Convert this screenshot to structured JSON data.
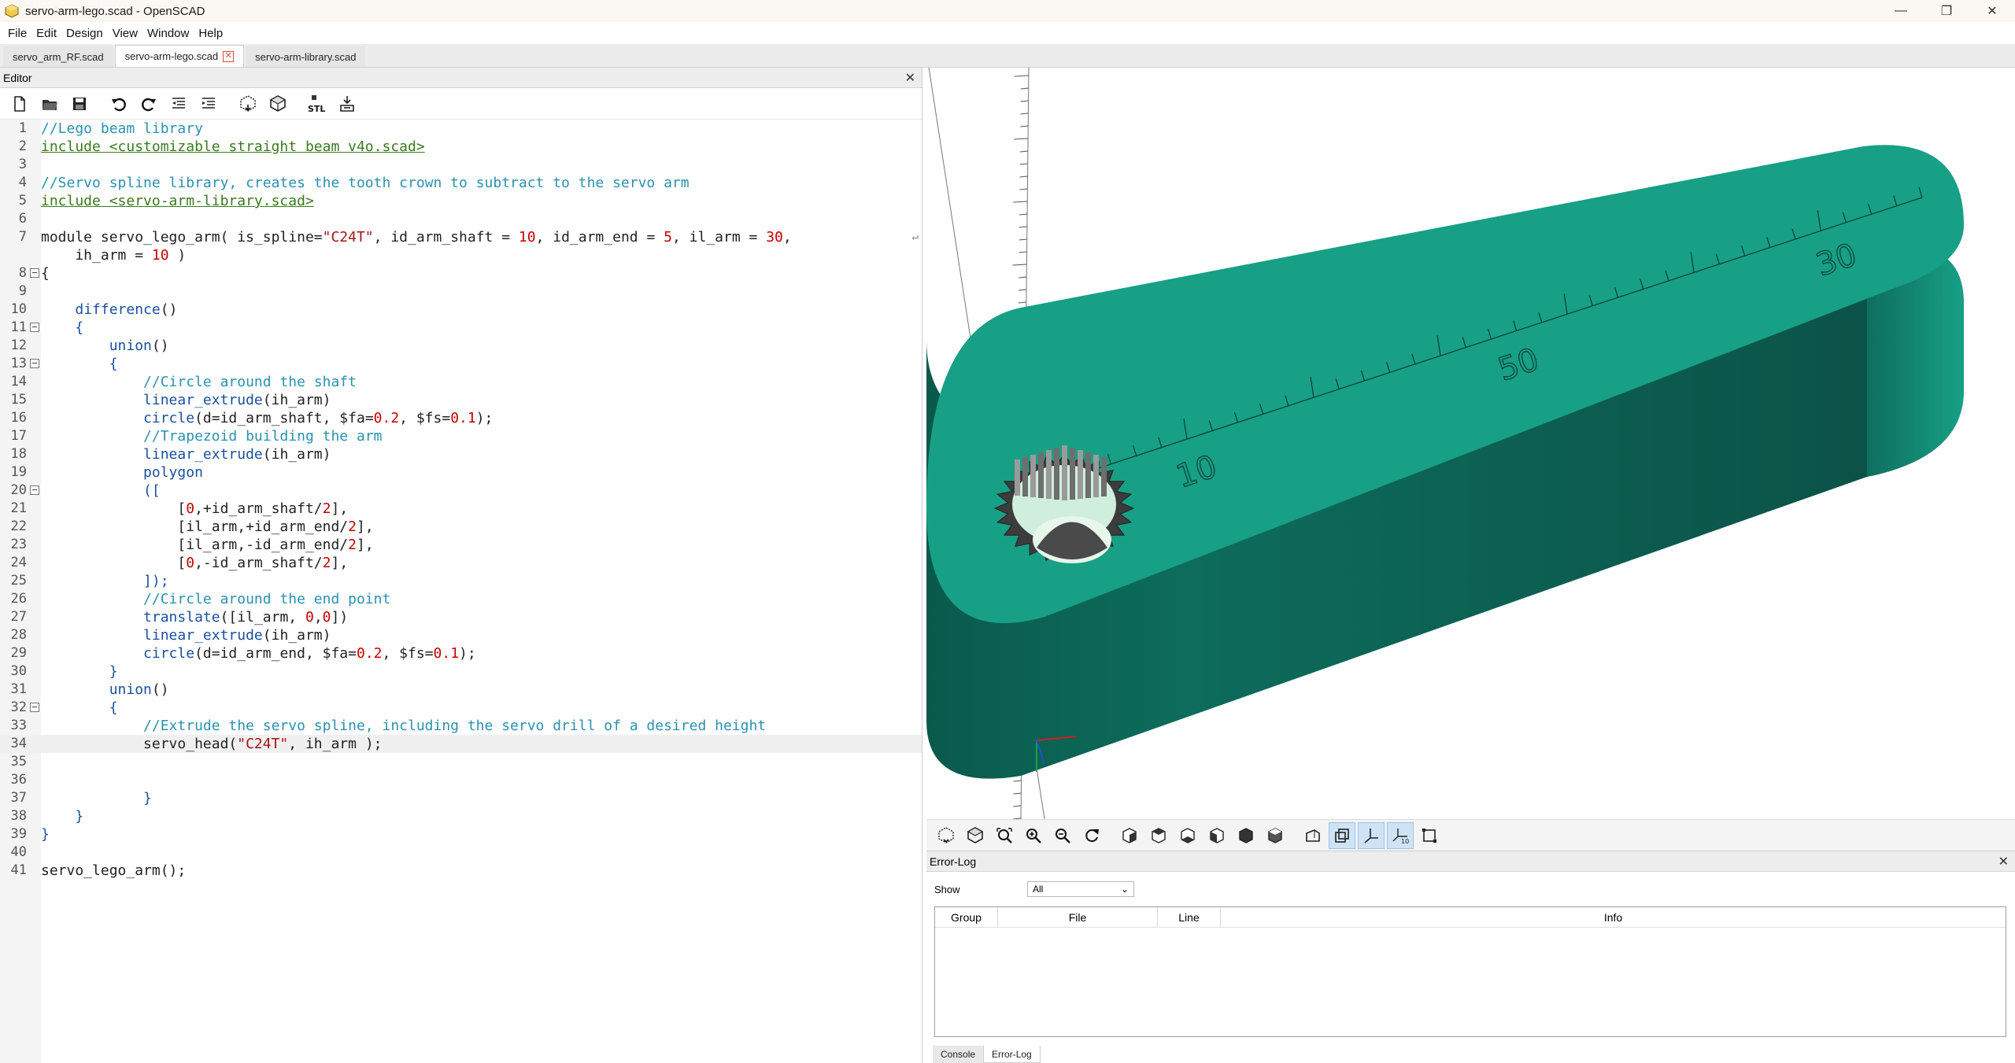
{
  "window": {
    "title": "servo-arm-lego.scad - OpenSCAD",
    "minimize_glyph": "—",
    "restore_glyph": "❐",
    "close_glyph": "✕"
  },
  "menu": [
    "File",
    "Edit",
    "Design",
    "View",
    "Window",
    "Help"
  ],
  "tabs": [
    {
      "label": "servo_arm_RF.scad",
      "active": false
    },
    {
      "label": "servo-arm-lego.scad",
      "active": true
    },
    {
      "label": "servo-arm-library.scad",
      "active": false
    }
  ],
  "editor": {
    "title": "Editor",
    "close_glyph": "✕",
    "toolbar_icons": [
      "new-file-icon",
      "open-file-icon",
      "save-icon",
      "undo-icon",
      "redo-icon",
      "unindent-icon",
      "indent-icon",
      "preview-icon",
      "render-icon",
      "export-stl-icon",
      "send-to-print-icon"
    ],
    "stl_label": "STL",
    "lines": [
      {
        "n": "1",
        "html": "<span class='c-comment'>//Lego beam library</span>"
      },
      {
        "n": "2",
        "html": "<span class='c-include'>include &lt;customizable straight beam v4o.scad&gt;</span>"
      },
      {
        "n": "3",
        "html": ""
      },
      {
        "n": "4",
        "html": "<span class='c-comment'>//Servo spline library, creates the tooth crown to subtract to the servo arm</span>"
      },
      {
        "n": "5",
        "html": "<span class='c-include'>include &lt;servo-arm-library.scad&gt;</span>"
      },
      {
        "n": "6",
        "html": ""
      },
      {
        "n": "7",
        "html": "module servo_lego_arm( is_spline=<span class='c-str'>\"C24T\"</span>, id_arm_shaft = <span class='c-num'>10</span>, id_arm_end = <span class='c-num'>5</span>, il_arm = <span class='c-num'>30</span>,",
        "wrap": true
      },
      {
        "n": "",
        "html": "    ih_arm = <span class='c-num'>10</span> )"
      },
      {
        "n": "8",
        "html": "{",
        "fold": true
      },
      {
        "n": "9",
        "html": ""
      },
      {
        "n": "10",
        "html": "    <span class='c-kw'>difference</span>()"
      },
      {
        "n": "11",
        "html": "    <span class='c-kw'>{</span>",
        "fold": true
      },
      {
        "n": "12",
        "html": "        <span class='c-kw'>union</span>()"
      },
      {
        "n": "13",
        "html": "        <span class='c-kw'>{</span>",
        "fold": true
      },
      {
        "n": "14",
        "html": "            <span class='c-comment'>//Circle around the shaft</span>"
      },
      {
        "n": "15",
        "html": "            <span class='c-kw'>linear_extrude</span>(ih_arm)"
      },
      {
        "n": "16",
        "html": "            <span class='c-kw'>circle</span>(d=id_arm_shaft, $fa=<span class='c-num'>0.2</span>, $fs=<span class='c-num'>0.1</span>);"
      },
      {
        "n": "17",
        "html": "            <span class='c-comment'>//Trapezoid building the arm</span>"
      },
      {
        "n": "18",
        "html": "            <span class='c-kw'>linear_extrude</span>(ih_arm)"
      },
      {
        "n": "19",
        "html": "            <span class='c-kw'>polygon</span>"
      },
      {
        "n": "20",
        "html": "            <span class='c-kw'>([</span>",
        "fold": true
      },
      {
        "n": "21",
        "html": "                [<span class='c-num'>0</span>,+id_arm_shaft/<span class='c-num'>2</span>],"
      },
      {
        "n": "22",
        "html": "                [il_arm,+id_arm_end/<span class='c-num'>2</span>],"
      },
      {
        "n": "23",
        "html": "                [il_arm,-id_arm_end/<span class='c-num'>2</span>],"
      },
      {
        "n": "24",
        "html": "                [<span class='c-num'>0</span>,-id_arm_shaft/<span class='c-num'>2</span>],"
      },
      {
        "n": "25",
        "html": "            <span class='c-kw'>]);</span>"
      },
      {
        "n": "26",
        "html": "            <span class='c-comment'>//Circle around the end point</span>"
      },
      {
        "n": "27",
        "html": "            <span class='c-kw'>translate</span>([il_arm, <span class='c-num'>0</span>,<span class='c-num'>0</span>])"
      },
      {
        "n": "28",
        "html": "            <span class='c-kw'>linear_extrude</span>(ih_arm)"
      },
      {
        "n": "29",
        "html": "            <span class='c-kw'>circle</span>(d=id_arm_end, $fa=<span class='c-num'>0.2</span>, $fs=<span class='c-num'>0.1</span>);"
      },
      {
        "n": "30",
        "html": "        <span class='c-kw'>}</span>"
      },
      {
        "n": "31",
        "html": "        <span class='c-kw'>union</span>()"
      },
      {
        "n": "32",
        "html": "        <span class='c-kw'>{</span>",
        "fold": true
      },
      {
        "n": "33",
        "html": "            <span class='c-comment'>//Extrude the servo spline, including the servo drill of a desired height</span>"
      },
      {
        "n": "34",
        "html": "            servo_head(<span class='c-str'>\"C24T\"</span>, ih_arm );",
        "current": true
      },
      {
        "n": "35",
        "html": ""
      },
      {
        "n": "36",
        "html": ""
      },
      {
        "n": "37",
        "html": "            <span class='c-kw'>}</span>"
      },
      {
        "n": "38",
        "html": "    <span class='c-kw'>}</span>"
      },
      {
        "n": "39",
        "html": "<span class='c-kw'>}</span>"
      },
      {
        "n": "40",
        "html": ""
      },
      {
        "n": "41",
        "html": "servo_lego_arm();"
      }
    ]
  },
  "viewport": {
    "model_color": "#17a085",
    "model_side_color": "#0e6b5c",
    "ruler_labels": [
      "10",
      "50",
      "30"
    ]
  },
  "view_toolbar": {
    "icons": [
      "preview-icon",
      "render-icon",
      "view-all-icon",
      "zoom-in-icon",
      "zoom-out-icon",
      "reset-view-icon",
      "view-right-icon",
      "view-top-icon",
      "view-bottom-icon",
      "view-left-icon",
      "view-front-icon",
      "view-back-icon",
      "perspective-icon",
      "orthogonal-icon",
      "show-axes-icon",
      "show-scale-markers-icon",
      "show-edges-icon"
    ]
  },
  "errorlog": {
    "title": "Error-Log",
    "close_glyph": "✕",
    "show_label": "Show",
    "show_value": "All",
    "columns": [
      "Group",
      "File",
      "Line",
      "Info"
    ],
    "bottom_tabs": [
      {
        "label": "Console",
        "active": false
      },
      {
        "label": "Error-Log",
        "active": true
      }
    ]
  }
}
